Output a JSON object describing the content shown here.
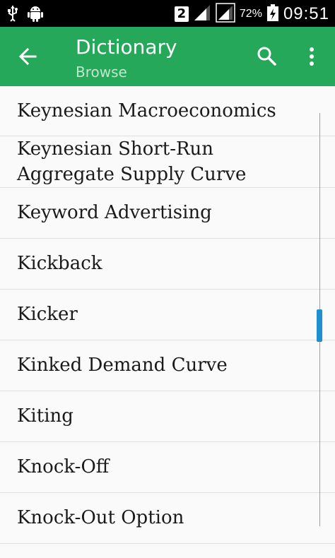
{
  "status_bar": {
    "sim_slot": "2",
    "battery_percent": "72%",
    "time": "09:51",
    "icons": [
      "usb-icon",
      "android-icon",
      "signal-icon",
      "signal-icon",
      "battery-charging-icon"
    ]
  },
  "app_bar": {
    "title": "Dictionary",
    "subtitle": "Browse",
    "color": "#25a85a"
  },
  "list": {
    "items": [
      "Keynesian Macroeconomics",
      "Keynesian Short-Run Aggregate Supply Curve",
      "Keyword Advertising",
      "Kickback",
      "Kicker",
      "Kinked Demand Curve",
      "Kiting",
      "Knock-Off",
      "Knock-Out Option"
    ]
  }
}
